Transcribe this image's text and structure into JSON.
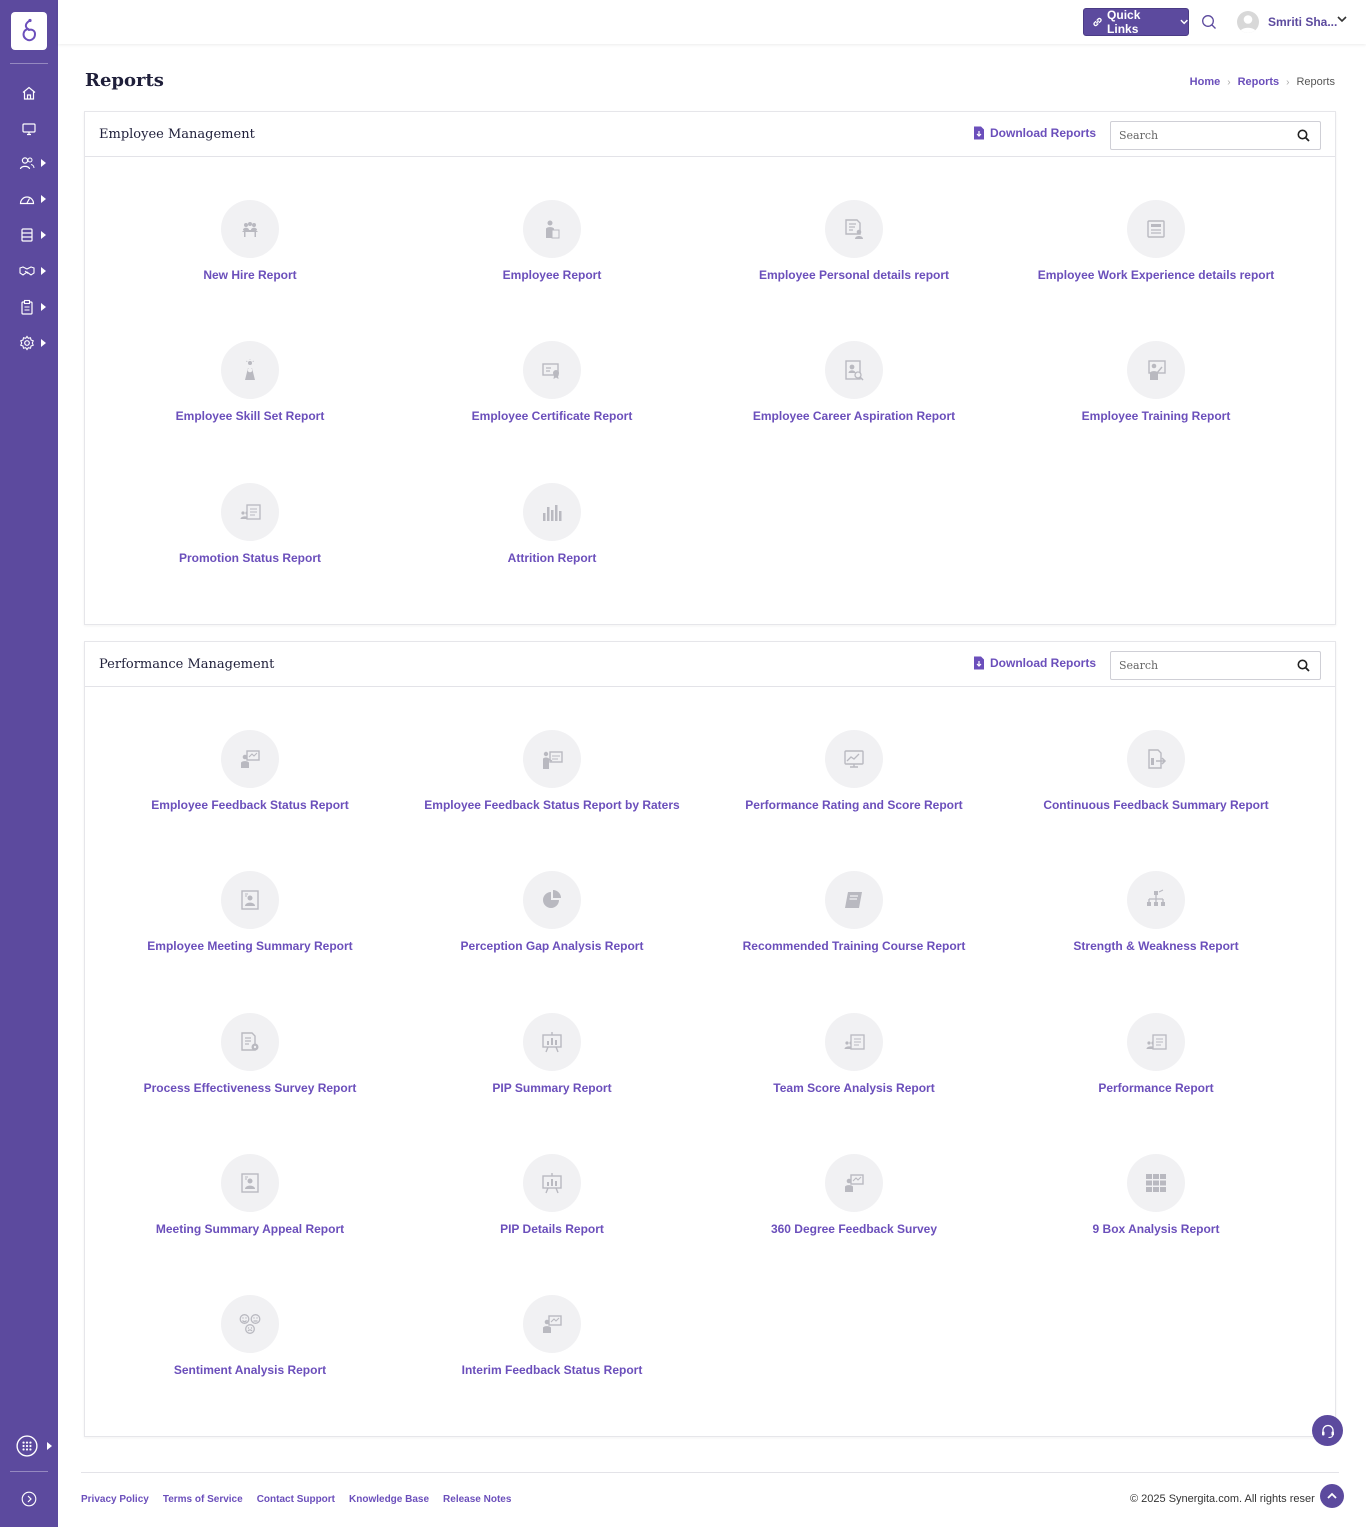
{
  "app": {
    "brand_color": "#5c4a9e",
    "accent_color": "#6b4fbb"
  },
  "sidebar": {
    "items": [
      {
        "icon": "home-icon",
        "has_submenu": false
      },
      {
        "icon": "monitor-icon",
        "has_submenu": false
      },
      {
        "icon": "users-icon",
        "has_submenu": true
      },
      {
        "icon": "dashboard-gauge-icon",
        "has_submenu": true
      },
      {
        "icon": "database-icon",
        "has_submenu": true
      },
      {
        "icon": "handshake-icon",
        "has_submenu": true
      },
      {
        "icon": "clipboard-icon",
        "has_submenu": true
      },
      {
        "icon": "settings-gear-icon",
        "has_submenu": true
      }
    ],
    "bottom_items": [
      {
        "icon": "apps-grid-icon",
        "has_submenu": true
      },
      {
        "icon": "expand-arrow-icon",
        "has_submenu": false
      }
    ]
  },
  "header": {
    "quick_links_label": "Quick Links",
    "user_name": "Smriti Sha..."
  },
  "page": {
    "title": "Reports",
    "breadcrumb": [
      "Home",
      "Reports",
      "Reports"
    ]
  },
  "sections": [
    {
      "title": "Employee Management",
      "download_label": "Download Reports",
      "search_placeholder": "Search",
      "reports": [
        {
          "label": "New Hire Report",
          "icon": "team-meeting-icon"
        },
        {
          "label": "Employee Report",
          "icon": "person-document-icon"
        },
        {
          "label": "Employee Personal details report",
          "icon": "document-person-icon"
        },
        {
          "label": "Employee Work Experience details report",
          "icon": "id-card-icon"
        },
        {
          "label": "Employee Skill Set Report",
          "icon": "person-idea-icon"
        },
        {
          "label": "Employee Certificate Report",
          "icon": "certificate-icon"
        },
        {
          "label": "Employee Career Aspiration Report",
          "icon": "profile-search-icon"
        },
        {
          "label": "Employee Training Report",
          "icon": "trainer-board-icon"
        },
        {
          "label": "Promotion Status Report",
          "icon": "group-report-icon"
        },
        {
          "label": "Attrition Report",
          "icon": "bar-chart-icon"
        }
      ]
    },
    {
      "title": "Performance Management",
      "download_label": "Download Reports",
      "search_placeholder": "Search",
      "reports": [
        {
          "label": "Employee Feedback Status Report",
          "icon": "presenter-icon"
        },
        {
          "label": "Employee Feedback Status Report by Raters",
          "icon": "presenter-board-icon"
        },
        {
          "label": "Performance Rating and Score Report",
          "icon": "monitor-chart-icon"
        },
        {
          "label": "Continuous Feedback Summary Report",
          "icon": "document-export-icon"
        },
        {
          "label": "Employee Meeting Summary Report",
          "icon": "meeting-screen-icon"
        },
        {
          "label": "Perception Gap Analysis Report",
          "icon": "pie-chart-icon"
        },
        {
          "label": "Recommended Training Course Report",
          "icon": "book-icon"
        },
        {
          "label": "Strength & Weakness Report",
          "icon": "org-chart-icon"
        },
        {
          "label": "Process Effectiveness Survey Report",
          "icon": "document-gear-icon"
        },
        {
          "label": "PIP Summary Report",
          "icon": "easel-chart-icon"
        },
        {
          "label": "Team Score Analysis Report",
          "icon": "group-report-icon"
        },
        {
          "label": "Performance Report",
          "icon": "group-report-icon"
        },
        {
          "label": "Meeting Summary Appeal Report",
          "icon": "meeting-screen-icon"
        },
        {
          "label": "PIP Details Report",
          "icon": "easel-chart-icon"
        },
        {
          "label": "360 Degree Feedback Survey",
          "icon": "presenter-icon"
        },
        {
          "label": "9 Box Analysis Report",
          "icon": "nine-grid-icon"
        },
        {
          "label": "Sentiment Analysis Report",
          "icon": "emotions-icon"
        },
        {
          "label": "Interim Feedback Status Report",
          "icon": "presenter-icon"
        }
      ]
    }
  ],
  "footer": {
    "links": [
      "Privacy Policy",
      "Terms of Service",
      "Contact Support",
      "Knowledge Base",
      "Release Notes"
    ],
    "copyright": "© 2025 Synergita.com. All rights reser"
  }
}
